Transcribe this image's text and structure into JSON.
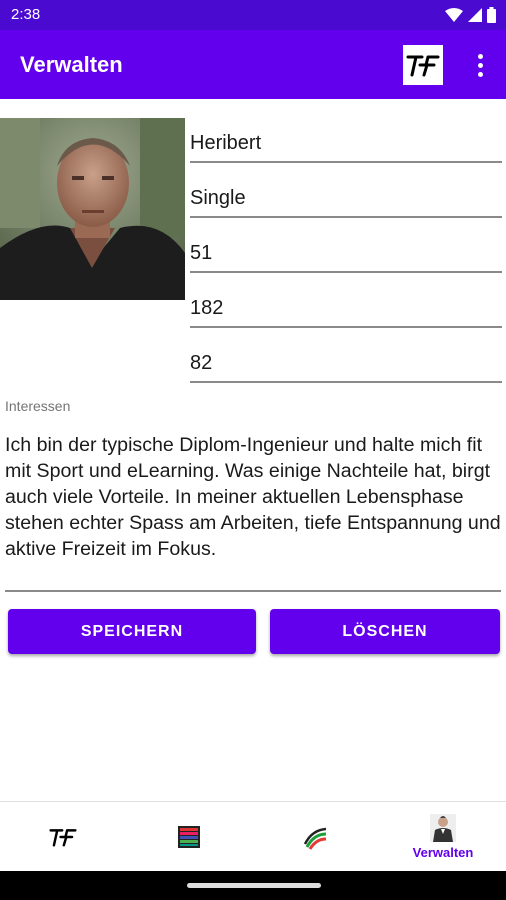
{
  "status_bar": {
    "time": "2:38"
  },
  "app_bar": {
    "title": "Verwalten",
    "logo_text": "TF"
  },
  "profile": {
    "name": "Heribert",
    "status": "Single",
    "age": "51",
    "height": "182",
    "weight": "82"
  },
  "interests": {
    "label": "Interessen",
    "text": "Ich bin der typische Diplom-Ingenieur und halte mich fit mit Sport und eLearning. Was einige Nachteile hat, birgt auch viele Vorteile. In meiner aktuellen Lebensphase stehen echter Spass am Arbeiten, tiefe Entspannung und aktive Freizeit im Fokus."
  },
  "buttons": {
    "save_label": "SPEICHERN",
    "delete_label": "LÖSCHEN"
  },
  "bottom_nav": {
    "items": [
      {
        "icon": "tf-logo-icon"
      },
      {
        "icon": "color-stripes-icon"
      },
      {
        "icon": "flag-arc-icon"
      },
      {
        "icon": "person-icon",
        "label": "Verwalten"
      }
    ]
  },
  "colors": {
    "primary": "#6200ee",
    "status_bar": "#4a0ad0"
  }
}
